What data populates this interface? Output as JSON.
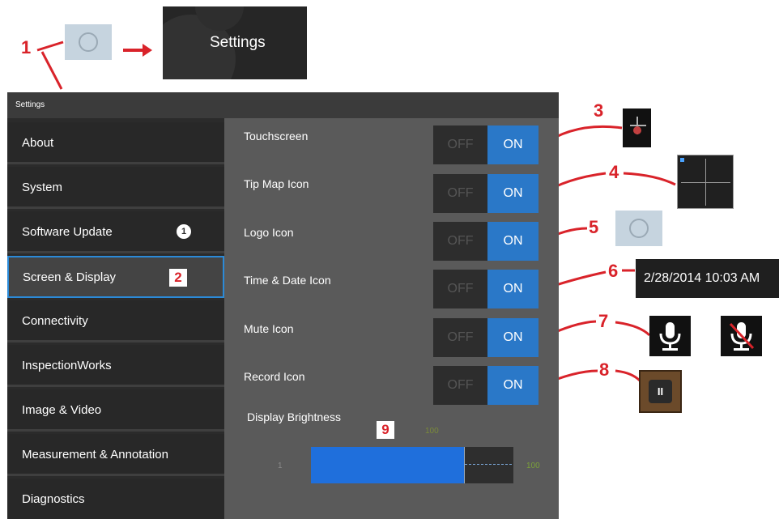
{
  "callouts": [
    "1",
    "2",
    "3",
    "4",
    "5",
    "6",
    "7",
    "8",
    "9"
  ],
  "top_button": {
    "label": "Settings"
  },
  "panel": {
    "title": "Settings",
    "sidebar": [
      {
        "label": "About"
      },
      {
        "label": "System"
      },
      {
        "label": "Software Update",
        "badge": "1"
      },
      {
        "label": "Screen & Display",
        "selected": true
      },
      {
        "label": "Connectivity"
      },
      {
        "label": "InspectionWorks"
      },
      {
        "label": "Image & Video"
      },
      {
        "label": "Measurement & Annotation"
      },
      {
        "label": "Diagnostics"
      }
    ],
    "settings": [
      {
        "label": "Touchscreen",
        "off": "OFF",
        "on": "ON"
      },
      {
        "label": "Tip Map Icon",
        "off": "OFF",
        "on": "ON"
      },
      {
        "label": "Logo Icon",
        "off": "OFF",
        "on": "ON"
      },
      {
        "label": "Time & Date Icon",
        "off": "OFF",
        "on": "ON"
      },
      {
        "label": "Mute Icon",
        "off": "OFF",
        "on": "ON"
      },
      {
        "label": "Record Icon",
        "off": "OFF",
        "on": "ON"
      }
    ],
    "brightness": {
      "label": "Display Brightness",
      "value": 100,
      "min_label": "1",
      "value_label": "100",
      "max_label": "100"
    }
  },
  "icons": {
    "datetime_text": "2/28/2014  10:03 AM",
    "record_glyph": "II"
  },
  "colors": {
    "callout_red": "#d9232a",
    "toggle_on": "#2a78c8",
    "selected_border": "#2b8ad8",
    "slider_fill": "#1f6fdc"
  }
}
